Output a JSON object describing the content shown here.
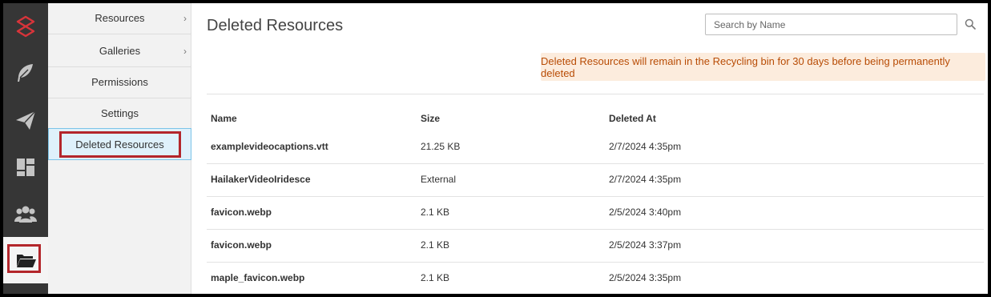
{
  "sidebar_icons": [
    {
      "name": "logo-icon",
      "active": false
    },
    {
      "name": "feather-icon",
      "active": false
    },
    {
      "name": "paper-plane-icon",
      "active": false
    },
    {
      "name": "dashboard-icon",
      "active": false
    },
    {
      "name": "users-icon",
      "active": false
    },
    {
      "name": "folder-open-icon",
      "active": true
    }
  ],
  "submenu": {
    "items": [
      {
        "label": "Resources",
        "has_chevron": true
      },
      {
        "label": "Galleries",
        "has_chevron": true
      },
      {
        "label": "Permissions",
        "has_chevron": false
      },
      {
        "label": "Settings",
        "has_chevron": false
      },
      {
        "label": "Deleted Resources",
        "has_chevron": false,
        "active": true
      }
    ]
  },
  "main": {
    "title": "Deleted Resources",
    "search_placeholder": "Search by Name",
    "notice": "Deleted Resources will remain in the Recycling bin for 30 days before being permanently deleted",
    "columns": [
      "Name",
      "Size",
      "Deleted At"
    ],
    "rows": [
      {
        "name": "examplevideocaptions.vtt",
        "size": "21.25 KB",
        "deleted_at": "2/7/2024 4:35pm"
      },
      {
        "name": "HailakerVideoIridesce",
        "size": "External",
        "deleted_at": "2/7/2024 4:35pm"
      },
      {
        "name": "favicon.webp",
        "size": "2.1 KB",
        "deleted_at": "2/5/2024 3:40pm"
      },
      {
        "name": "favicon.webp",
        "size": "2.1 KB",
        "deleted_at": "2/5/2024 3:37pm"
      },
      {
        "name": "maple_favicon.webp",
        "size": "2.1 KB",
        "deleted_at": "2/5/2024 3:35pm"
      }
    ]
  },
  "colors": {
    "rail_bg": "#363636",
    "accent_red": "#b3262b",
    "notice_bg": "#fcecdd",
    "notice_text": "#b84c05",
    "active_submenu_bg": "#dff1fb"
  }
}
